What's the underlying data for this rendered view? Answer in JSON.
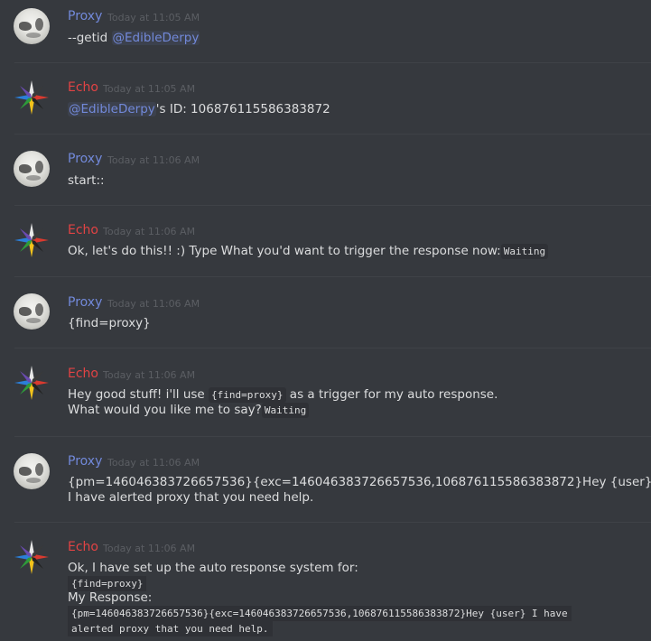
{
  "messages": [
    {
      "author": "Proxy",
      "time": "Today at 11:05 AM",
      "text_prefix": "--getid ",
      "mention": "@EdibleDerpy"
    },
    {
      "author": "Echo",
      "time": "Today at 11:05 AM",
      "mention": "@EdibleDerpy",
      "text_suffix": "'s ID: 106876115586383872"
    },
    {
      "author": "Proxy",
      "time": "Today at 11:06 AM",
      "text": "start::"
    },
    {
      "author": "Echo",
      "time": "Today at 11:06 AM",
      "text": "Ok, let's do this!! :) Type What you'd want to trigger the response now:",
      "code": "Waiting"
    },
    {
      "author": "Proxy",
      "time": "Today at 11:06 AM",
      "text": "{find=proxy}"
    },
    {
      "author": "Echo",
      "time": "Today at 11:06 AM",
      "text_prefix": "Hey good stuff! i'll use ",
      "code": "{find=proxy}",
      "text_suffix": " as a trigger for my auto response.",
      "line2": "What would you like me to say?",
      "code2": "Waiting"
    },
    {
      "author": "Proxy",
      "time": "Today at 11:06 AM",
      "line1": "{pm=146046383726657536}{exc=146046383726657536,106876115586383872}Hey {user}",
      "line2": "I have alerted proxy that you need help."
    },
    {
      "author": "Echo",
      "time": "Today at 11:06 AM",
      "line1": "Ok, I have set up the auto response system for:",
      "code1": "{find=proxy}",
      "line3": "My Response:",
      "code2a": "{pm=146046383726657536}{exc=146046383726657536,106876115586383872}Hey {user} I have",
      "code2b": "alerted proxy that you need help."
    }
  ]
}
